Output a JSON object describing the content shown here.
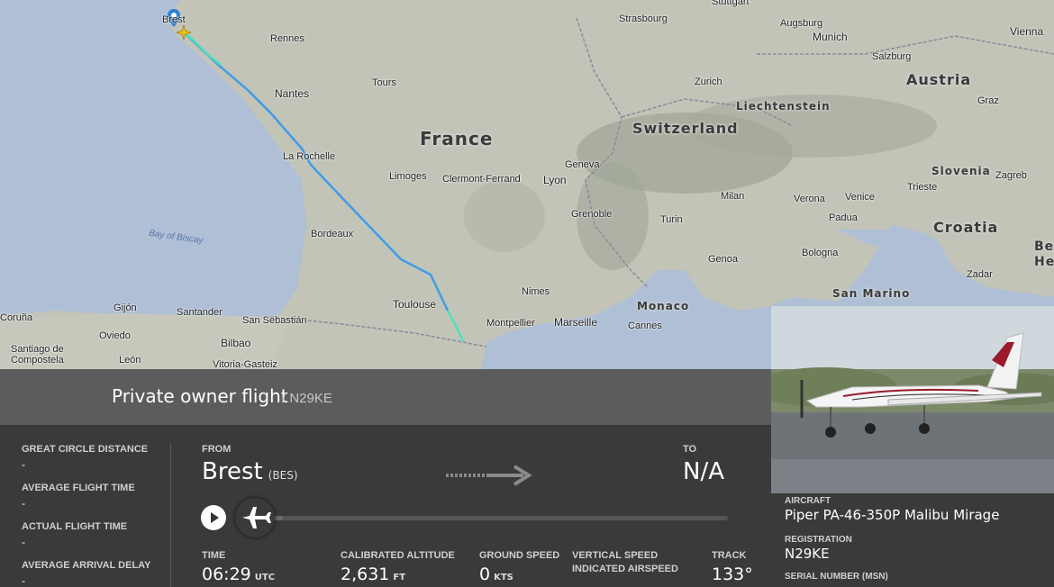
{
  "map": {
    "countries": [
      {
        "name": "France"
      },
      {
        "name": "Switzerland"
      },
      {
        "name": "Austria"
      },
      {
        "name": "Liechtenstein"
      },
      {
        "name": "Slovenia"
      },
      {
        "name": "Croatia"
      },
      {
        "name": "Monaco"
      },
      {
        "name": "San Marino"
      },
      {
        "name": "Be He"
      }
    ],
    "cities": [
      "Brest",
      "Rennes",
      "Nantes",
      "Tours",
      "La Rochelle",
      "Limoges",
      "Clermont-Ferrand",
      "Lyon",
      "Geneva",
      "Bordeaux",
      "Toulouse",
      "Montpellier",
      "Marseille",
      "Nimes",
      "Cannes",
      "Genoa",
      "Grenoble",
      "Turin",
      "Milan",
      "Verona",
      "Venice",
      "Padua",
      "Trieste",
      "Zagreb",
      "Bologna",
      "Zadar",
      "Strasbourg",
      "Zurich",
      "Augsburg",
      "Munich",
      "Salzburg",
      "Graz",
      "Vienna",
      "Stuttgart",
      "Coruña",
      "Gijón",
      "Oviedo",
      "Santander",
      "San Sebastián",
      "Bilbao",
      "Vitoria-Gasteiz",
      "León",
      "Santiago de Compostela"
    ],
    "sea_label": "Bay of Biscay"
  },
  "flight": {
    "title": "Private owner flight",
    "callsign": "/ N29KE",
    "from_label": "FROM",
    "from_city": "Brest",
    "from_code": "(BES)",
    "to_label": "TO",
    "to_city": "N/A"
  },
  "stats": [
    {
      "label": "GREAT CIRCLE DISTANCE",
      "value": "-"
    },
    {
      "label": "AVERAGE FLIGHT TIME",
      "value": "-"
    },
    {
      "label": "ACTUAL FLIGHT TIME",
      "value": "-"
    },
    {
      "label": "AVERAGE ARRIVAL DELAY",
      "value": "-"
    }
  ],
  "metrics": {
    "time_label": "TIME",
    "time_value": "06:29",
    "time_unit": "UTC",
    "alt_label": "CALIBRATED ALTITUDE",
    "alt_value": "2,631",
    "alt_unit": "FT",
    "gs_label": "GROUND SPEED",
    "gs_value": "0",
    "gs_unit": "KTS",
    "vs_label": "VERTICAL SPEED",
    "ias_label": "INDICATED AIRSPEED",
    "track_label": "TRACK",
    "track_value": "133°"
  },
  "aircraft": {
    "aircraft_label": "AIRCRAFT",
    "aircraft_value": "Piper PA-46-350P Malibu Mirage",
    "reg_label": "REGISTRATION",
    "reg_value": "N29KE",
    "serial_label": "SERIAL NUMBER (MSN)"
  },
  "progress": {
    "fraction": 0.05
  },
  "colors": {
    "track_blue": "#3f9ce8",
    "track_cyan": "#4fe0c0",
    "panel": "#3a3a3a"
  },
  "icons": [
    "play-icon",
    "plane-icon",
    "arrow-right-icon",
    "map-pin-icon"
  ]
}
